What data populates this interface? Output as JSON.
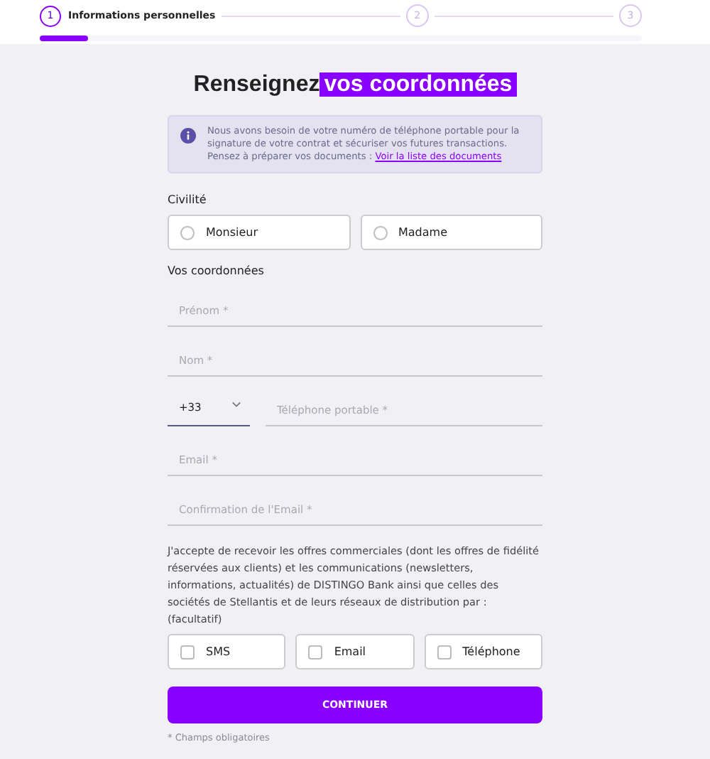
{
  "stepper": {
    "steps": [
      {
        "number": "1",
        "label": "Informations personnelles",
        "selected": true
      },
      {
        "number": "2",
        "selected": false
      },
      {
        "number": "3",
        "selected": false
      }
    ],
    "progress": {
      "level": 0.08
    }
  },
  "heading": {
    "text": "Renseignez",
    "highlight": "vos coordonnées"
  },
  "info": {
    "text": "Nous avons besoin de votre numéro de téléphone portable pour la signature de votre contrat et sécuriser vos futures transactions. Pensez à préparer vos documents : ",
    "link": "Voir la liste des documents"
  },
  "civility": {
    "label": "Civilité",
    "options": [
      {
        "label": "Monsieur",
        "selected": false
      },
      {
        "label": "Madame",
        "selected": false
      }
    ]
  },
  "contact": {
    "label": "Vos coordonnées",
    "fields": [
      {
        "kind": "text",
        "placeholder": "Prénom *"
      },
      {
        "kind": "text",
        "placeholder": "Nom *"
      },
      {
        "kind": "phone",
        "prefix": "+33",
        "placeholder": "Téléphone portable *"
      },
      {
        "kind": "text",
        "placeholder": "Email *"
      },
      {
        "kind": "text",
        "placeholder": "Confirmation de l'Email *"
      }
    ]
  },
  "consent": {
    "text": "J'accepte de recevoir les offres commerciales (dont les offres de fidélité réservées aux clients) et les communications (newsletters, informations, actualités) de DISTINGO Bank ainsi que celles des sociétés de Stellantis et de leurs réseaux de distribution par : (facultatif)",
    "options": [
      {
        "label": "SMS",
        "checked": false
      },
      {
        "label": "Email",
        "checked": false
      },
      {
        "label": "Téléphone",
        "checked": false
      }
    ]
  },
  "button": "CONTINUER",
  "footnote": "* Champs obligatoires"
}
